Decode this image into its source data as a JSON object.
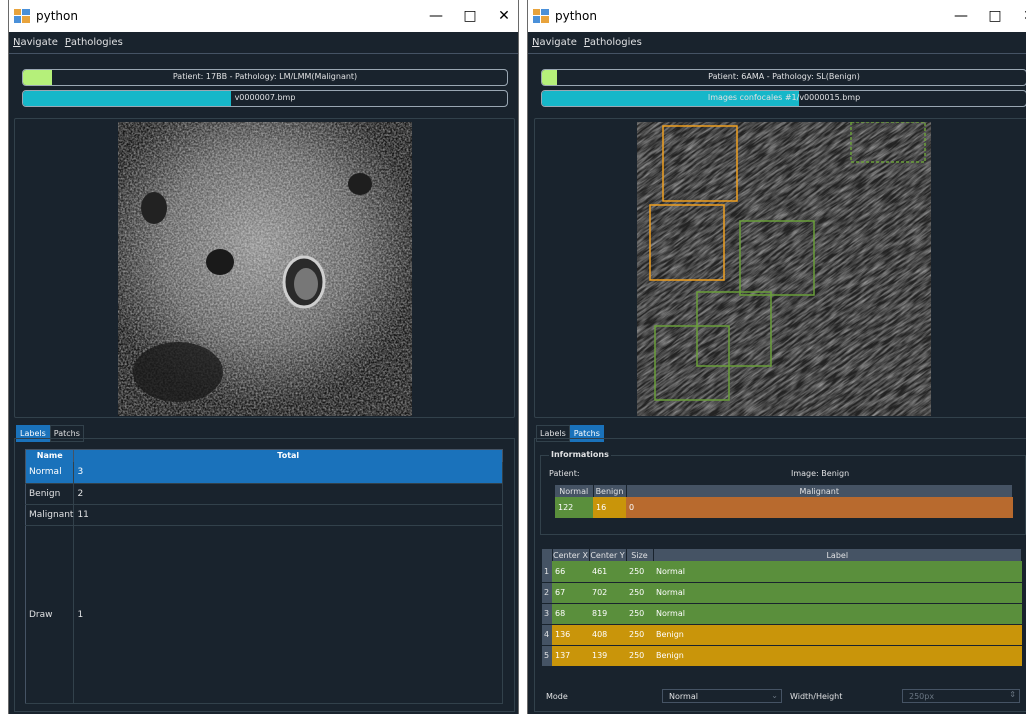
{
  "colors": {
    "normal": "#5a8f3c",
    "benign": "#c9950a",
    "malignant": "#b86a2e",
    "progress_green": "#b5f07a",
    "progress_cyan": "#16b7c9",
    "accent": "#1a72bb",
    "box_orange": "#f0a020",
    "box_green": "#6a9f3a"
  },
  "icons": {
    "app": "python-app-icon",
    "minimize": "minimize-icon",
    "maximize": "maximize-icon",
    "close": "close-icon",
    "dropdown": "chevron-down-icon",
    "spinner": "spinner-icon"
  },
  "left": {
    "title": "python",
    "menu": {
      "navigate": "Navigate",
      "pathologies": "Pathologies"
    },
    "patient_bar": {
      "text": "Patient: 17BB - Pathology: LM/LMM(Malignant)",
      "progress": 0.06
    },
    "image_bar": {
      "text": "v0000007.bmp",
      "progress": 0.43
    },
    "tabs": {
      "labels": "Labels",
      "patchs": "Patchs"
    },
    "table": {
      "headers": [
        "Name",
        "Total"
      ],
      "rows": [
        {
          "name": "Normal",
          "total": "3"
        },
        {
          "name": "Benign",
          "total": "2"
        },
        {
          "name": "Malignant",
          "total": "11"
        },
        {
          "name": "Draw",
          "total": "1"
        }
      ]
    }
  },
  "right": {
    "title": "python",
    "menu": {
      "navigate": "Navigate",
      "pathologies": "Pathologies"
    },
    "patient_bar": {
      "text": "Patient: 6AMA - Pathology: SL(Benign)",
      "progress": 0.03
    },
    "image_bar": {
      "text": "Images confocales #1/v0000015.bmp",
      "progress": 0.53
    },
    "tabs": {
      "labels": "Labels",
      "patchs": "Patchs"
    },
    "informations": {
      "title": "Informations",
      "patient": "Patient:",
      "image": "Image: Benign",
      "predictions": {
        "headers": [
          "Normal",
          "Benign",
          "Malignant"
        ],
        "values": [
          "122",
          "16",
          "0"
        ]
      }
    },
    "patches": {
      "headers": [
        "Center X",
        "Center Y",
        "Size",
        "Label"
      ],
      "rows": [
        {
          "n": "1",
          "x": "66",
          "y": "461",
          "size": "250",
          "label": "Normal"
        },
        {
          "n": "2",
          "x": "67",
          "y": "702",
          "size": "250",
          "label": "Normal"
        },
        {
          "n": "3",
          "x": "68",
          "y": "819",
          "size": "250",
          "label": "Normal"
        },
        {
          "n": "4",
          "x": "136",
          "y": "408",
          "size": "250",
          "label": "Benign"
        },
        {
          "n": "5",
          "x": "137",
          "y": "139",
          "size": "250",
          "label": "Benign"
        }
      ]
    },
    "mode_label": "Mode",
    "mode_value": "Normal",
    "size_label": "Width/Height",
    "size_value": "250px"
  }
}
